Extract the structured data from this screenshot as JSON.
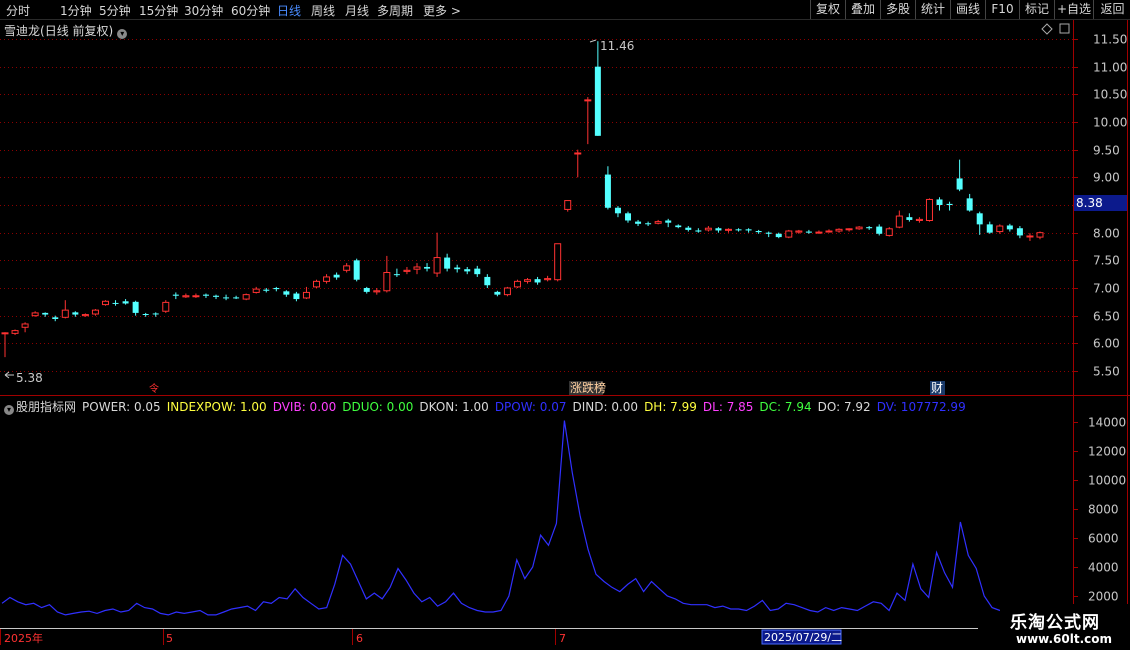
{
  "toolbar": {
    "periods": [
      "分时",
      "1分钟",
      "5分钟",
      "15分钟",
      "30分钟",
      "60分钟",
      "日线",
      "周线",
      "月线",
      "多周期",
      "更多"
    ],
    "active_period": "日线",
    "more_arrow": ">",
    "right_buttons": [
      "复权",
      "叠加",
      "多股",
      "统计",
      "画线",
      "F10",
      "标记",
      "+自选",
      "返回"
    ]
  },
  "stock": {
    "name": "雪迪龙",
    "mode": "(日线 前复权)",
    "price_high_label": "11.46",
    "price_low_label": "5.38",
    "current_price": "8.38",
    "markers": [
      "涨跌榜",
      "财",
      "令"
    ]
  },
  "colors": {
    "up": "#ff3232",
    "down": "#54ffff",
    "grid": "#8b0000",
    "axis_text": "#c8c8c8",
    "line": "#3030ff",
    "current_price_bg": "#0c1a8c"
  },
  "price_axis": {
    "ticks": [
      "11.50",
      "11.00",
      "10.50",
      "10.00",
      "9.50",
      "9.00",
      "8.50",
      "8.00",
      "7.50",
      "7.00",
      "6.50",
      "6.00",
      "5.50"
    ]
  },
  "indicator": {
    "name": "股朋指标网",
    "values": [
      {
        "label": "POWER: 0.05",
        "color": "#d8d8d8"
      },
      {
        "label": "INDEXPOW: 1.00",
        "color": "#ffff40"
      },
      {
        "label": "DVIB: 0.00",
        "color": "#ff40ff"
      },
      {
        "label": "DDUO: 0.00",
        "color": "#40ff40"
      },
      {
        "label": "DKON: 1.00",
        "color": "#d8d8d8"
      },
      {
        "label": "DPOW: 0.07",
        "color": "#3030ff"
      },
      {
        "label": "DIND: 0.00",
        "color": "#d8d8d8"
      },
      {
        "label": "DH: 7.99",
        "color": "#ffff40"
      },
      {
        "label": "DL: 7.85",
        "color": "#ff40ff"
      },
      {
        "label": "DC: 7.94",
        "color": "#40ff40"
      },
      {
        "label": "DO: 7.92",
        "color": "#d8d8d8"
      },
      {
        "label": "DV: 107772.99",
        "color": "#3030ff"
      }
    ],
    "axis_ticks": [
      "14000",
      "12000",
      "10000",
      "8000",
      "6000",
      "4000",
      "2000"
    ]
  },
  "time_axis": {
    "labels": [
      "2025年",
      "5",
      "6",
      "7"
    ],
    "cursor_date": "2025/07/29/二"
  },
  "watermark": {
    "title": "乐淘公式网",
    "url": "www.60lt.com"
  },
  "candles": [
    [
      6.19,
      6.19,
      5.75,
      6.2
    ],
    [
      6.18,
      6.23,
      6.15,
      6.25
    ],
    [
      6.29,
      6.35,
      6.2,
      6.38
    ],
    [
      6.5,
      6.55,
      6.48,
      6.58
    ],
    [
      6.55,
      6.52,
      6.48,
      6.56
    ],
    [
      6.47,
      6.44,
      6.4,
      6.5
    ],
    [
      6.47,
      6.6,
      6.45,
      6.78
    ],
    [
      6.56,
      6.52,
      6.48,
      6.58
    ],
    [
      6.5,
      6.52,
      6.48,
      6.54
    ],
    [
      6.53,
      6.6,
      6.5,
      6.62
    ],
    [
      6.7,
      6.76,
      6.68,
      6.78
    ],
    [
      6.73,
      6.72,
      6.68,
      6.78
    ],
    [
      6.76,
      6.72,
      6.7,
      6.8
    ],
    [
      6.75,
      6.55,
      6.5,
      6.77
    ],
    [
      6.53,
      6.52,
      6.48,
      6.55
    ],
    [
      6.54,
      6.53,
      6.48,
      6.56
    ],
    [
      6.58,
      6.74,
      6.55,
      6.78
    ],
    [
      6.88,
      6.86,
      6.8,
      6.92
    ],
    [
      6.84,
      6.86,
      6.82,
      6.9
    ],
    [
      6.85,
      6.86,
      6.82,
      6.9
    ],
    [
      6.88,
      6.86,
      6.82,
      6.9
    ],
    [
      6.86,
      6.84,
      6.8,
      6.88
    ],
    [
      6.83,
      6.82,
      6.78,
      6.88
    ],
    [
      6.83,
      6.82,
      6.8,
      6.86
    ],
    [
      6.8,
      6.88,
      6.78,
      6.9
    ],
    [
      6.92,
      6.98,
      6.9,
      7.02
    ],
    [
      6.97,
      6.95,
      6.92,
      7.0
    ],
    [
      7.0,
      6.98,
      6.94,
      7.02
    ],
    [
      6.94,
      6.88,
      6.84,
      6.96
    ],
    [
      6.9,
      6.8,
      6.76,
      6.93
    ],
    [
      6.82,
      6.92,
      6.8,
      7.02
    ],
    [
      7.02,
      7.12,
      7.0,
      7.15
    ],
    [
      7.12,
      7.2,
      7.08,
      7.25
    ],
    [
      7.24,
      7.19,
      7.15,
      7.28
    ],
    [
      7.32,
      7.4,
      7.28,
      7.45
    ],
    [
      7.5,
      7.15,
      7.12,
      7.53
    ],
    [
      7.0,
      6.93,
      6.9,
      7.02
    ],
    [
      6.93,
      6.95,
      6.88,
      7.0
    ],
    [
      6.95,
      7.28,
      6.92,
      7.58
    ],
    [
      7.25,
      7.24,
      7.2,
      7.35
    ],
    [
      7.3,
      7.32,
      7.25,
      7.38
    ],
    [
      7.34,
      7.38,
      7.25,
      7.45
    ],
    [
      7.38,
      7.35,
      7.3,
      7.45
    ],
    [
      7.27,
      7.55,
      7.2,
      8.0
    ],
    [
      7.55,
      7.35,
      7.3,
      7.62
    ],
    [
      7.37,
      7.34,
      7.28,
      7.42
    ],
    [
      7.34,
      7.3,
      7.25,
      7.38
    ],
    [
      7.35,
      7.25,
      7.2,
      7.4
    ],
    [
      7.2,
      7.05,
      7.0,
      7.25
    ],
    [
      6.93,
      6.88,
      6.85,
      6.95
    ],
    [
      6.88,
      7.0,
      6.85,
      7.02
    ],
    [
      7.02,
      7.12,
      7.0,
      7.15
    ],
    [
      7.12,
      7.15,
      7.08,
      7.18
    ],
    [
      7.16,
      7.1,
      7.06,
      7.2
    ],
    [
      7.15,
      7.17,
      7.12,
      7.22
    ],
    [
      7.15,
      7.8,
      7.12,
      7.8
    ],
    [
      8.42,
      8.58,
      8.38,
      8.58
    ],
    [
      9.44,
      9.44,
      9.0,
      9.5
    ],
    [
      10.4,
      10.4,
      9.6,
      10.45
    ],
    [
      11.0,
      9.75,
      9.75,
      11.46
    ],
    [
      9.05,
      8.45,
      8.42,
      9.2
    ],
    [
      8.45,
      8.35,
      8.28,
      8.48
    ],
    [
      8.35,
      8.22,
      8.18,
      8.38
    ],
    [
      8.2,
      8.16,
      8.12,
      8.23
    ],
    [
      8.17,
      8.16,
      8.12,
      8.2
    ],
    [
      8.17,
      8.2,
      8.15,
      8.23
    ],
    [
      8.22,
      8.18,
      8.1,
      8.25
    ],
    [
      8.13,
      8.1,
      8.08,
      8.15
    ],
    [
      8.09,
      8.05,
      8.02,
      8.12
    ],
    [
      8.04,
      8.02,
      8.0,
      8.08
    ],
    [
      8.05,
      8.08,
      8.02,
      8.12
    ],
    [
      8.08,
      8.04,
      8.0,
      8.1
    ],
    [
      8.05,
      8.06,
      8.0,
      8.08
    ],
    [
      8.06,
      8.05,
      8.02,
      8.08
    ],
    [
      8.06,
      8.04,
      8.0,
      8.08
    ],
    [
      8.03,
      8.01,
      7.98,
      8.05
    ],
    [
      8.0,
      7.98,
      7.92,
      8.02
    ],
    [
      7.98,
      7.92,
      7.9,
      8.0
    ],
    [
      7.92,
      8.03,
      7.9,
      8.05
    ],
    [
      8.01,
      8.03,
      7.98,
      8.05
    ],
    [
      8.02,
      8.0,
      7.98,
      8.05
    ],
    [
      8.0,
      8.01,
      7.98,
      8.04
    ],
    [
      8.02,
      8.03,
      8.0,
      8.06
    ],
    [
      8.03,
      8.06,
      8.0,
      8.08
    ],
    [
      8.06,
      8.07,
      8.02,
      8.08
    ],
    [
      8.07,
      8.1,
      8.05,
      8.12
    ],
    [
      8.1,
      8.08,
      8.05,
      8.12
    ],
    [
      8.11,
      7.98,
      7.95,
      8.15
    ],
    [
      7.95,
      8.07,
      7.93,
      8.1
    ],
    [
      8.1,
      8.3,
      8.08,
      8.4
    ],
    [
      8.28,
      8.23,
      8.2,
      8.35
    ],
    [
      8.22,
      8.24,
      8.18,
      8.28
    ],
    [
      8.22,
      8.6,
      8.2,
      8.62
    ],
    [
      8.6,
      8.5,
      8.4,
      8.64
    ],
    [
      8.52,
      8.5,
      8.4,
      8.56
    ],
    [
      8.98,
      8.78,
      8.75,
      9.32
    ],
    [
      8.62,
      8.4,
      8.38,
      8.7
    ],
    [
      8.35,
      8.15,
      7.96,
      8.38
    ],
    [
      8.15,
      8.0,
      7.98,
      8.2
    ],
    [
      8.02,
      8.12,
      7.98,
      8.15
    ],
    [
      8.13,
      8.06,
      8.02,
      8.16
    ],
    [
      8.08,
      7.95,
      7.9,
      8.12
    ],
    [
      7.93,
      7.94,
      7.85,
      7.99
    ],
    [
      7.92,
      8.0,
      7.88,
      8.02
    ]
  ],
  "volume": [
    1500,
    1900,
    1600,
    1400,
    1500,
    1200,
    1400,
    900,
    700,
    800,
    900,
    950,
    800,
    1000,
    1100,
    900,
    1000,
    1500,
    1200,
    1100,
    800,
    700,
    900,
    800,
    900,
    1000,
    700,
    700,
    900,
    1100,
    1200,
    1300,
    1000,
    1600,
    1500,
    1900,
    1800,
    2500,
    1900,
    1500,
    1100,
    1200,
    2800,
    4800,
    4200,
    3000,
    1800,
    2200,
    1800,
    2600,
    3900,
    3100,
    2200,
    1600,
    1900,
    1300,
    1600,
    2200,
    1500,
    1200,
    1000,
    900,
    900,
    1000,
    2000,
    4500,
    3200,
    4000,
    6200,
    5500,
    7000,
    14100,
    10500,
    7500,
    5200,
    3500,
    3000,
    2600,
    2300,
    2800,
    3200,
    2300,
    3000,
    2500,
    2000,
    1800,
    1500,
    1400,
    1400,
    1400,
    1200,
    1300,
    1100,
    1100,
    1000,
    1300,
    1700,
    1000,
    1100,
    1500,
    1400,
    1200,
    1000,
    900,
    1200,
    1000,
    1200,
    1100,
    1000,
    1300,
    1600,
    1500,
    1000,
    2200,
    1700,
    4200,
    2500,
    1900,
    5000,
    3600,
    2600,
    7100,
    4800,
    3900,
    2000,
    1200,
    1000
  ]
}
